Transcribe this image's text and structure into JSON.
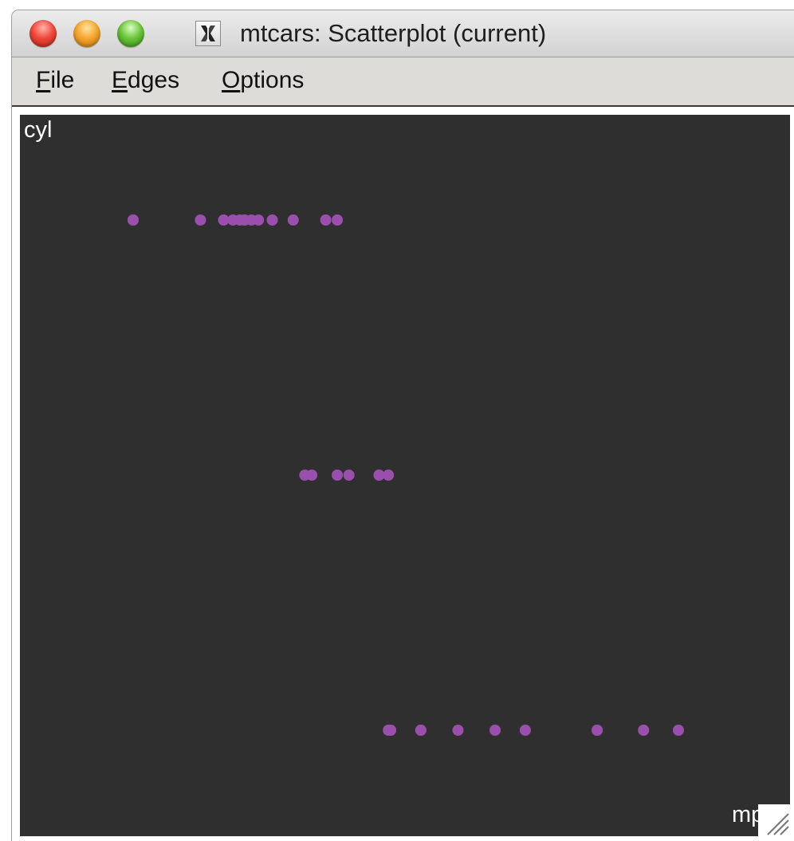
{
  "window": {
    "title": "mtcars: Scatterplot (current)",
    "controls": [
      "close-icon",
      "minimize-icon",
      "zoom-icon"
    ],
    "app_icon": "x11-icon"
  },
  "menu": {
    "items": [
      {
        "label": "File",
        "mnemonic": "F",
        "rest": "ile"
      },
      {
        "label": "Edges",
        "mnemonic": "E",
        "rest": "dges"
      },
      {
        "label": "Options",
        "mnemonic": "O",
        "rest": "ptions"
      }
    ]
  },
  "plot": {
    "background": "#2f2f2f",
    "point_color": "#9b4fad",
    "y_label": "cyl",
    "x_label": "mpg"
  },
  "chart_data": {
    "type": "scatter",
    "xlabel": "mpg",
    "ylabel": "cyl",
    "xlim": [
      10.4,
      33.9
    ],
    "ylim": [
      4,
      8
    ],
    "grid": false,
    "points": [
      {
        "x": 10.4,
        "y": 8
      },
      {
        "x": 10.4,
        "y": 8
      },
      {
        "x": 13.3,
        "y": 8
      },
      {
        "x": 14.3,
        "y": 8
      },
      {
        "x": 14.7,
        "y": 8
      },
      {
        "x": 15.0,
        "y": 8
      },
      {
        "x": 15.2,
        "y": 8
      },
      {
        "x": 15.2,
        "y": 8
      },
      {
        "x": 15.5,
        "y": 8
      },
      {
        "x": 15.8,
        "y": 8
      },
      {
        "x": 16.4,
        "y": 8
      },
      {
        "x": 17.3,
        "y": 8
      },
      {
        "x": 18.7,
        "y": 8
      },
      {
        "x": 19.2,
        "y": 8
      },
      {
        "x": 17.8,
        "y": 6
      },
      {
        "x": 18.1,
        "y": 6
      },
      {
        "x": 19.2,
        "y": 6
      },
      {
        "x": 19.7,
        "y": 6
      },
      {
        "x": 21.0,
        "y": 6
      },
      {
        "x": 21.0,
        "y": 6
      },
      {
        "x": 21.4,
        "y": 6
      },
      {
        "x": 21.4,
        "y": 4
      },
      {
        "x": 21.5,
        "y": 4
      },
      {
        "x": 22.8,
        "y": 4
      },
      {
        "x": 22.8,
        "y": 4
      },
      {
        "x": 24.4,
        "y": 4
      },
      {
        "x": 26.0,
        "y": 4
      },
      {
        "x": 27.3,
        "y": 4
      },
      {
        "x": 30.4,
        "y": 4
      },
      {
        "x": 30.4,
        "y": 4
      },
      {
        "x": 32.4,
        "y": 4
      },
      {
        "x": 33.9,
        "y": 4
      }
    ]
  }
}
